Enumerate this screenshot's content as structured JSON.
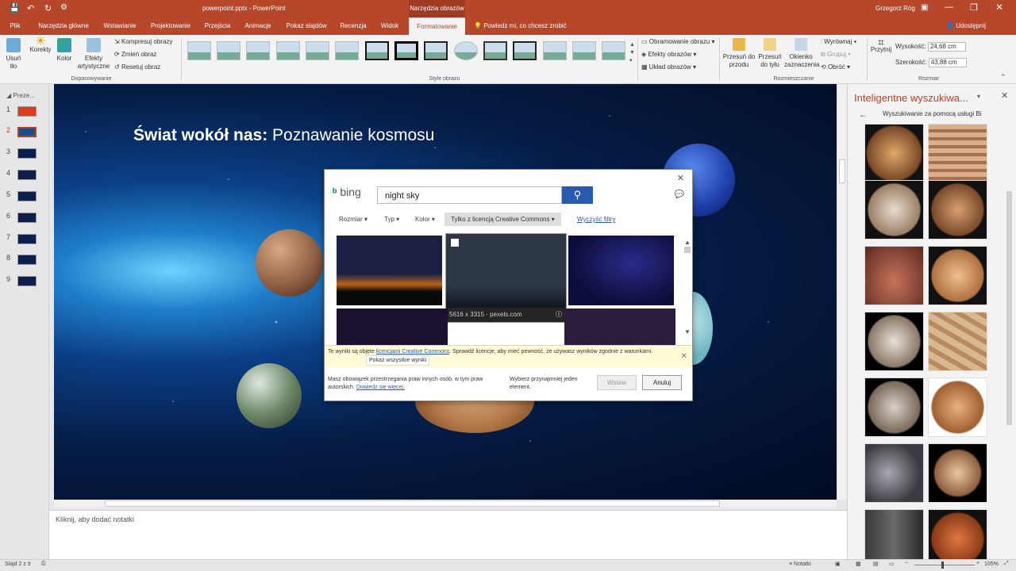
{
  "titlebar": {
    "file": "powerpoint.pptx",
    "sep": " - ",
    "app": "PowerPoint",
    "context_group": "Narzędzia obrazów",
    "user": "Grzegorz Róg"
  },
  "tabs": [
    "Plik",
    "Narzędzia główne",
    "Wstawianie",
    "Projektowanie",
    "Przejścia",
    "Animacje",
    "Pokaz slajdów",
    "Recenzja",
    "Widok",
    "Formatowanie"
  ],
  "tell_me": "Powiedz mi, co chcesz zrobić",
  "share": "Udostępnij",
  "ribbon": {
    "remove_bg": "Usuń tło",
    "corrections": "Korekty",
    "color": "Kolor",
    "artistic": "Efekty artystyczne",
    "compress": "Kompresuj obrazy",
    "change": "Zmień obraz",
    "reset": "Resetuj obraz",
    "group_adjust": "Dopasowywanie",
    "group_styles": "Style obrazu",
    "border": "Obramowanie obrazu",
    "effects": "Efekty obrazów",
    "layout": "Układ obrazów",
    "forward": "Przesuń do przodu",
    "backward": "Przesuń do tyłu",
    "selection": "Okienko zaznaczenia",
    "align": "Wyrównaj",
    "group": "Grupuj",
    "rotate": "Obróć",
    "group_arrange": "Rozmieszczanie",
    "crop": "Przytnij",
    "height_label": "Wysokość:",
    "height_value": "24,68 cm",
    "width_label": "Szerokość:",
    "width_value": "43,88 cm",
    "group_size": "Rozmiar"
  },
  "slides_panel": {
    "label": "Preze...",
    "numbers": [
      "1",
      "2",
      "3",
      "4",
      "5",
      "6",
      "7",
      "8",
      "9"
    ]
  },
  "slide": {
    "title_bold": "Świat wokół nas:",
    "title_rest": " Poznawanie kosmosu"
  },
  "dialog": {
    "brand": "bing",
    "query": "night sky",
    "filters": [
      "Rozmiar",
      "Typ",
      "Kolor",
      "Tylko z licencją Creative Commons"
    ],
    "clear": "Wyczyść filtry",
    "hover_info": "5616 x 3315 · pexels.com",
    "notice_pre": "Te wyniki są objęte ",
    "notice_link": "licencjami Creative Commons",
    "notice_post": ". Sprawdź licencje, aby mieć pewność, że używasz wyników zgodnie z warunkami.",
    "show_all": "Pokaż wszystkie wyniki",
    "copyright": "Masz obowiązek przestrzegania praw innych osób, w tym praw autorskich.",
    "learn_more": "Dowiedz się więcej.",
    "select_hint": "Wybierz przynajmniej jeden element.",
    "insert": "Wstaw",
    "cancel": "Anuluj"
  },
  "smart_lookup": {
    "title": "Inteligentne wyszukiwa...",
    "subtitle": "Wyszukiwanie za pomocą usługi Bi"
  },
  "notes_placeholder": "Kliknij, aby dodać notatki",
  "status": {
    "slide": "Slajd 2 z 9",
    "notes": "Notatki",
    "zoom": "105%"
  }
}
